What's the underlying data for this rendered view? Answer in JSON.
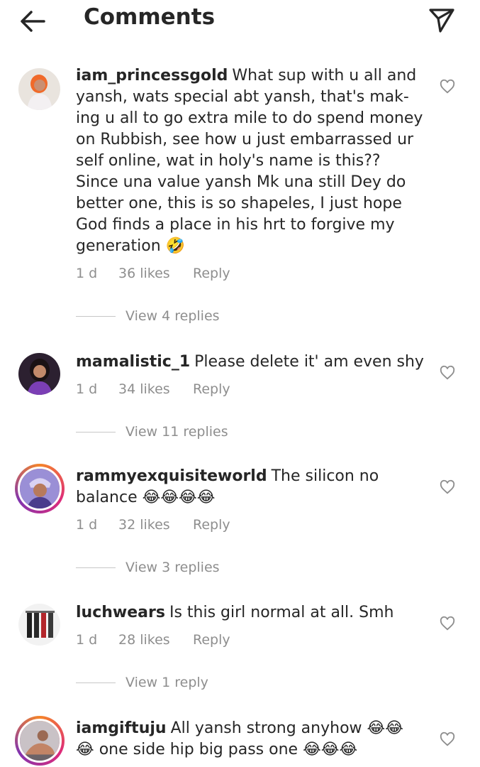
{
  "header": {
    "title": "Comments",
    "back_icon": "arrow-left-icon",
    "send_icon": "paper-plane-icon"
  },
  "comments": [
    {
      "username": "iam_princessgold",
      "text": "What sup with u all and yansh, wats special abt yansh, that's mak-ing u all to go extra mile to do spend money on Rubbish, see how u just embarrassed ur self online, wat in holy's name is this?? Since una value yansh Mk una still Dey do better one, this is so shapeles, I just hope God finds a place in his hrt to forgive my generation",
      "emoji": "🤣",
      "time": "1 d",
      "likes": "36 likes",
      "reply": "Reply",
      "view_replies": "View 4 replies"
    },
    {
      "username": "mamalistic_1",
      "text": "Please delete it' am even shy",
      "emoji": "",
      "time": "1 d",
      "likes": "34 likes",
      "reply": "Reply",
      "view_replies": "View 11 replies"
    },
    {
      "username": "rammyexquisiteworld",
      "text": "The silicon no balance",
      "emoji": "😂😂😂😂",
      "time": "1 d",
      "likes": "32 likes",
      "reply": "Reply",
      "view_replies": "View 3 replies"
    },
    {
      "username": "luchwears",
      "text": "Is this girl normal at all. Smh",
      "emoji": "",
      "time": "1 d",
      "likes": "28 likes",
      "reply": "Reply",
      "view_replies": "View 1 reply"
    },
    {
      "username": "iamgiftuju",
      "text": "All yansh strong anyhow",
      "emoji": "😂😂",
      "text2": "one side hip big pass one",
      "emoji2": "😂😂😂",
      "emoji_lead": "😂"
    }
  ]
}
